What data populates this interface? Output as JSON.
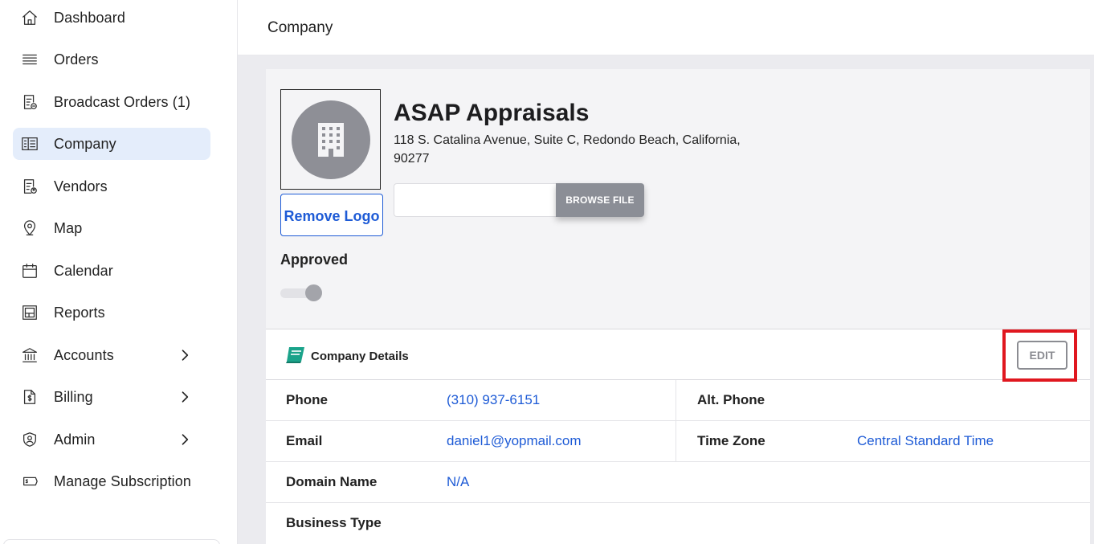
{
  "sidebar": {
    "items": [
      {
        "label": "Dashboard",
        "icon": "home-icon"
      },
      {
        "label": "Orders",
        "icon": "list-icon"
      },
      {
        "label": "Broadcast Orders (1)",
        "icon": "broadcast-orders-icon"
      },
      {
        "label": "Company",
        "icon": "company-icon",
        "active": true
      },
      {
        "label": "Vendors",
        "icon": "vendors-icon"
      },
      {
        "label": "Map",
        "icon": "map-pin-icon"
      },
      {
        "label": "Calendar",
        "icon": "calendar-icon"
      },
      {
        "label": "Reports",
        "icon": "reports-icon"
      },
      {
        "label": "Accounts",
        "icon": "bank-icon",
        "has_submenu": true
      },
      {
        "label": "Billing",
        "icon": "billing-icon",
        "has_submenu": true
      },
      {
        "label": "Admin",
        "icon": "shield-user-icon",
        "has_submenu": true
      },
      {
        "label": "Manage Subscription",
        "icon": "subscription-icon"
      }
    ]
  },
  "header": {
    "title": "Company"
  },
  "company": {
    "name": "ASAP Appraisals",
    "address": "118 S. Catalina Avenue, Suite C, Redondo Beach, California, 90277",
    "remove_logo_label": "Remove Logo",
    "browse_file_label": "BROWSE FILE",
    "approved_label": "Approved",
    "approved": false
  },
  "details": {
    "title": "Company Details",
    "edit_label": "EDIT",
    "phone_label": "Phone",
    "phone_value": "(310) 937-6151",
    "alt_phone_label": "Alt. Phone",
    "alt_phone_value": "",
    "email_label": "Email",
    "email_value": "daniel1@yopmail.com",
    "timezone_label": "Time Zone",
    "timezone_value": "Central Standard Time",
    "domain_label": "Domain Name",
    "domain_value": "N/A",
    "business_type_label": "Business Type",
    "business_type_value": ""
  },
  "colors": {
    "accent": "#1e5bd6",
    "active_nav_bg": "#e4edfb",
    "highlight": "#e0171f",
    "book_icon": "#1aa38a"
  }
}
